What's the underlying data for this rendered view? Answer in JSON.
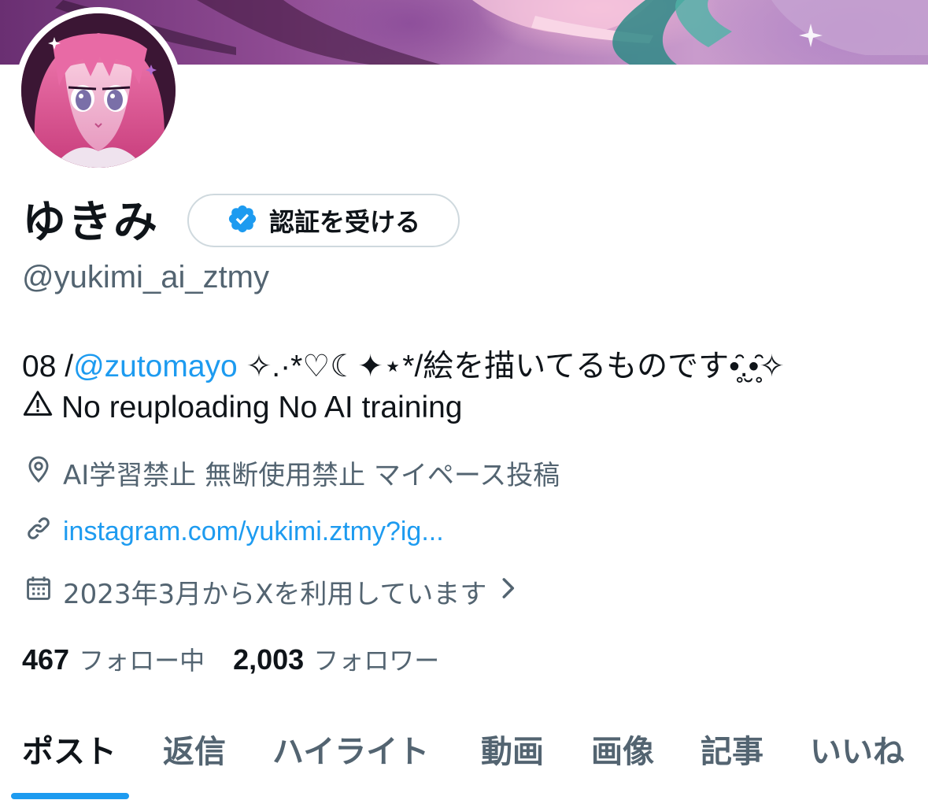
{
  "profile": {
    "display_name": "ゆきみ",
    "verify_button_label": "認証を受ける",
    "handle": "@yukimi_ai_ztmy"
  },
  "bio": {
    "line1_prefix": "08 /",
    "line1_mention": "@zutomayo",
    "line1_suffix": " ✧.·*♡☾✦⋆*/絵を描いてるものです•̥̑.̮•̥̑✧",
    "line2_icon": "warning-icon",
    "line2_text": "No reuploading No AI training"
  },
  "meta": {
    "location_icon": "location-pin-icon",
    "location": "AI学習禁止 無断使用禁止 マイペース投稿",
    "link_icon": "link-icon",
    "link": "instagram.com/yukimi.ztmy?ig...",
    "joined_icon": "calendar-icon",
    "joined": "2023年3月からXを利用しています",
    "joined_chevron_icon": "chevron-right-icon"
  },
  "follows": {
    "following_count": "467",
    "following_label": "フォロー中",
    "followers_count": "2,003",
    "followers_label": "フォロワー"
  },
  "tabs": [
    {
      "label": "ポスト",
      "active": true
    },
    {
      "label": "返信",
      "active": false
    },
    {
      "label": "ハイライト",
      "active": false
    },
    {
      "label": "動画",
      "active": false
    },
    {
      "label": "画像",
      "active": false
    },
    {
      "label": "記事",
      "active": false
    },
    {
      "label": "いいね",
      "active": false
    }
  ],
  "colors": {
    "accent": "#1d9bf0",
    "text_primary": "#0f1419",
    "text_secondary": "#536471",
    "border": "#cfd9de"
  }
}
